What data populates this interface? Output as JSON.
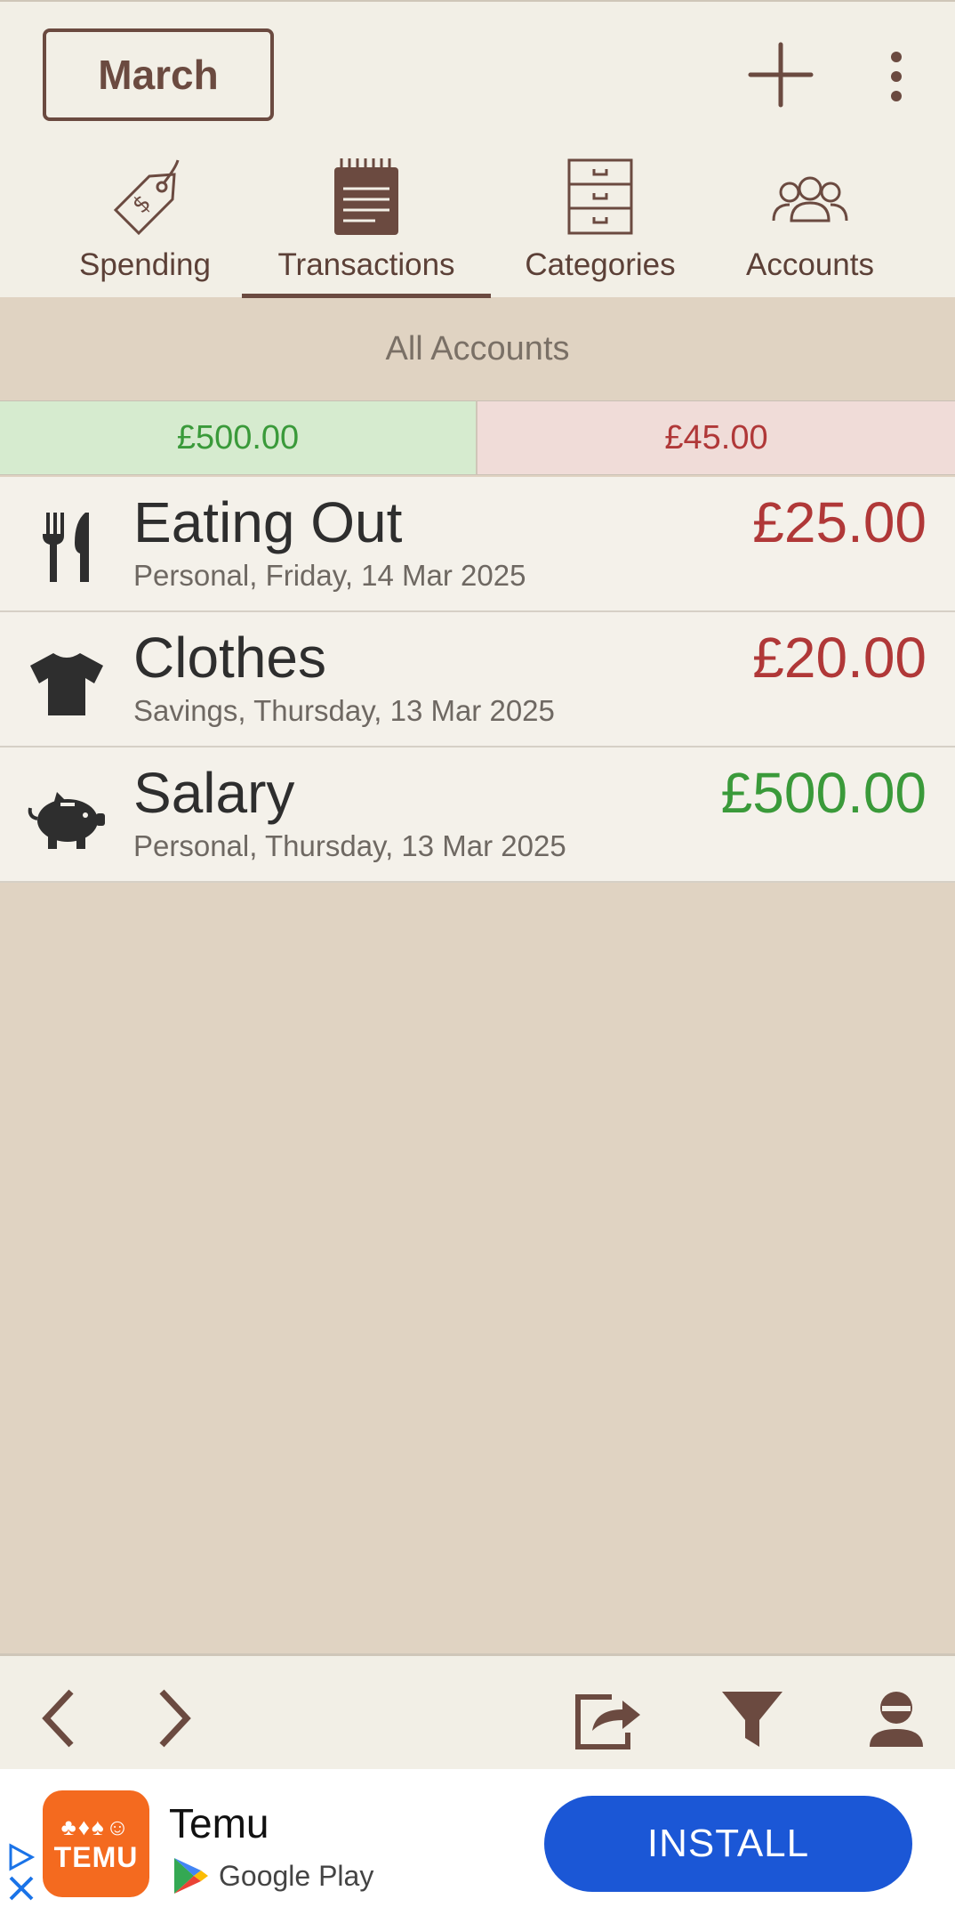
{
  "header": {
    "month_label": "March",
    "tabs": [
      {
        "label": "Spending",
        "icon": "price-tag-icon"
      },
      {
        "label": "Transactions",
        "icon": "notepad-icon",
        "selected": true
      },
      {
        "label": "Categories",
        "icon": "filing-cabinet-icon"
      },
      {
        "label": "Accounts",
        "icon": "people-icon"
      }
    ]
  },
  "filter": {
    "accounts_label": "All Accounts"
  },
  "summary": {
    "income": "£500.00",
    "expense": "£45.00"
  },
  "transactions": [
    {
      "title": "Eating Out",
      "subtitle": "Personal, Friday, 14 Mar 2025",
      "amount": "£25.00",
      "type": "expense",
      "icon": "cutlery-icon"
    },
    {
      "title": "Clothes",
      "subtitle": "Savings, Thursday, 13 Mar 2025",
      "amount": "£20.00",
      "type": "expense",
      "icon": "tshirt-icon"
    },
    {
      "title": "Salary",
      "subtitle": "Personal, Thursday, 13 Mar 2025",
      "amount": "£500.00",
      "type": "income",
      "icon": "piggy-bank-icon"
    }
  ],
  "ad": {
    "app_name": "Temu",
    "logo_text": "TEMU",
    "store": "Google Play",
    "install_label": "INSTALL"
  },
  "colors": {
    "brand_brown": "#6b4a40",
    "income_green": "#3a9a3a",
    "expense_red": "#b03838",
    "install_blue": "#1b57d6"
  }
}
